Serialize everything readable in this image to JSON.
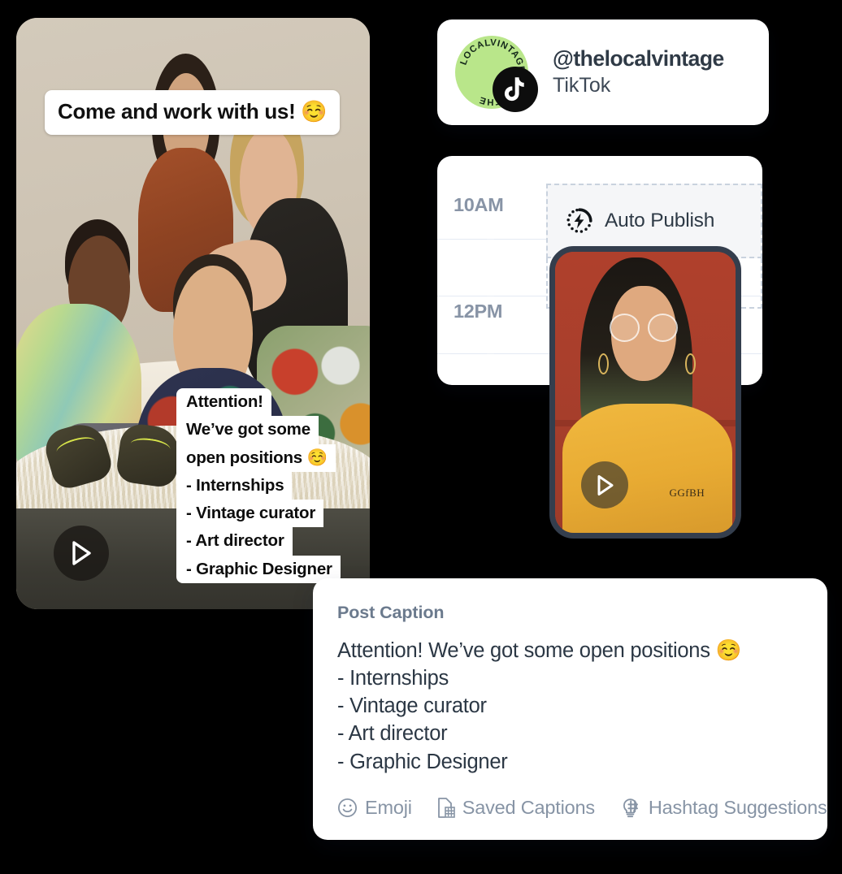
{
  "video_preview": {
    "headline_sticker": "Come and work with us! ☺️",
    "overlay_caption_lines": [
      "Attention!",
      "We’ve got some",
      "open positions ☺️",
      "- Internships",
      "- Vintage curator",
      "- Art director",
      "- Graphic Designer"
    ],
    "play_button_label": "Play"
  },
  "account_card": {
    "handle": "@thelocalvintage",
    "platform": "TikTok",
    "avatar_ring_text": "THE LOCAL VINTAGE",
    "avatar_words": [
      "LOCAL",
      "VINTAGE",
      "THE"
    ],
    "badge_icon": "tiktok-icon",
    "avatar_color": "#b9e68a",
    "badge_color": "#0d0d0d"
  },
  "scheduler": {
    "time_slots": [
      "10AM",
      "12PM"
    ],
    "auto_publish_label": "Auto Publish",
    "auto_publish_icon": "auto-publish-bolt-icon",
    "gridline_color": "#e4eaf3",
    "dropzone_border_color": "#c9d2de"
  },
  "phone_preview": {
    "play_button_label": "Play",
    "shirt_logo": "GGfBH"
  },
  "caption_panel": {
    "title": "Post Caption",
    "body": "Attention! We’ve got some open positions ☺️\n- Internships\n- Vintage curator\n- Art director\n- Graphic Designer",
    "toolbar": [
      {
        "label": "Emoji",
        "icon": "smiley-icon"
      },
      {
        "label": "Saved Captions",
        "icon": "document-hash-icon"
      },
      {
        "label": "Hashtag Suggestions",
        "icon": "lightbulb-hash-icon"
      }
    ]
  },
  "colors": {
    "background": "#000000",
    "card_surface": "#ffffff",
    "text_dark": "#2b3744",
    "text_muted": "#8794a5",
    "phone_frame": "#343e4d"
  }
}
